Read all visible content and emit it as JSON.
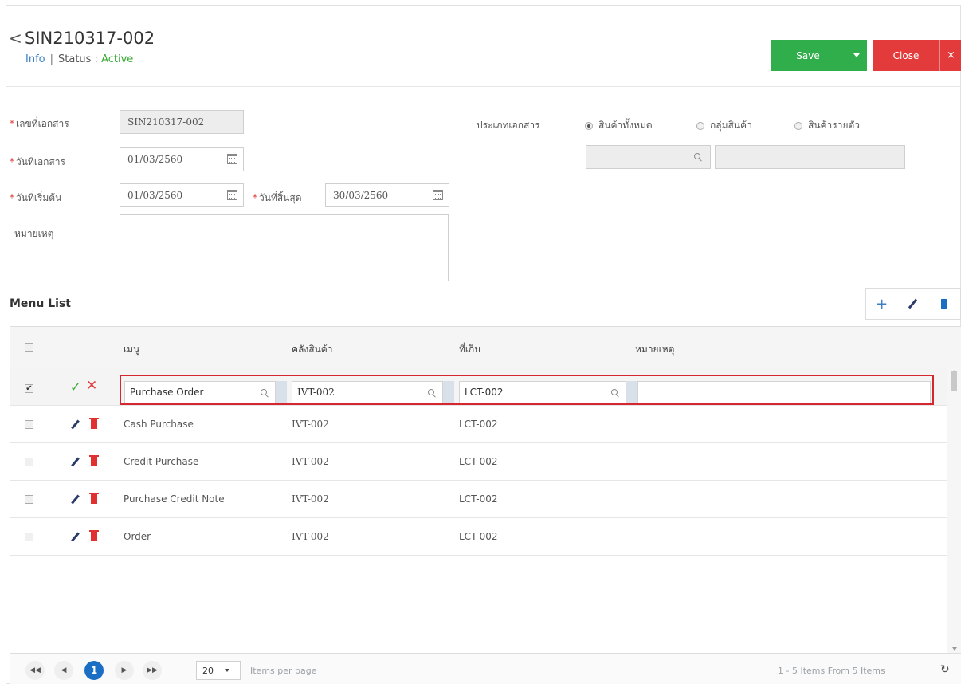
{
  "header": {
    "back_glyph": "<",
    "doc_no": "SIN210317-002",
    "info_link": "Info",
    "separator": "|",
    "status_label": "Status :",
    "status_value": "Active",
    "save_label": "Save",
    "close_label": "Close",
    "close_x": "×"
  },
  "form": {
    "doc_no_label": "เลขที่เอกสาร",
    "doc_no_value": "SIN210317-002",
    "doc_date_label": "วันที่เอกสาร",
    "doc_date_value": "01/03/2560",
    "start_date_label": "วันที่เริ่มต้น",
    "start_date_value": "01/03/2560",
    "end_date_label": "วันที่สิ้นสุด",
    "end_date_value": "30/03/2560",
    "remark_label": "หมายเหตุ",
    "doc_type_label": "ประเภทเอกสาร",
    "radio_all": "สินค้าทั้งหมด",
    "radio_group": "กลุ่มสินค้า",
    "radio_item": "สินค้ารายตัว",
    "selected_radio": "radio_all"
  },
  "menu_list": {
    "title": "Menu List",
    "columns": [
      "เมนู",
      "คลังสินค้า",
      "ที่เก็บ",
      "หมายเหตุ"
    ],
    "edit_row": {
      "menu": "Purchase Order",
      "warehouse": "IVT-002",
      "location": "LCT-002",
      "remark": ""
    },
    "rows": [
      {
        "menu": "Cash Purchase",
        "warehouse": "IVT-002",
        "location": "LCT-002",
        "remark": ""
      },
      {
        "menu": "Credit Purchase",
        "warehouse": "IVT-002",
        "location": "LCT-002",
        "remark": ""
      },
      {
        "menu": "Purchase Credit Note",
        "warehouse": "IVT-002",
        "location": "LCT-002",
        "remark": ""
      },
      {
        "menu": "Order",
        "warehouse": "IVT-002",
        "location": "LCT-002",
        "remark": ""
      }
    ]
  },
  "pager": {
    "first": "◀◀",
    "prev": "◀",
    "current_page": "1",
    "next": "▶",
    "last": "▶▶",
    "page_size": "20",
    "items_per_page": "Items per page",
    "summary": "1 - 5 Items From 5 Items",
    "refresh_glyph": "↻"
  },
  "colors": {
    "save": "#2fae4b",
    "close": "#e33b3b",
    "active": "#3aaa35",
    "link": "#3b7fc4",
    "highlight_border": "#d62731",
    "current_page": "#1a6fc4"
  }
}
